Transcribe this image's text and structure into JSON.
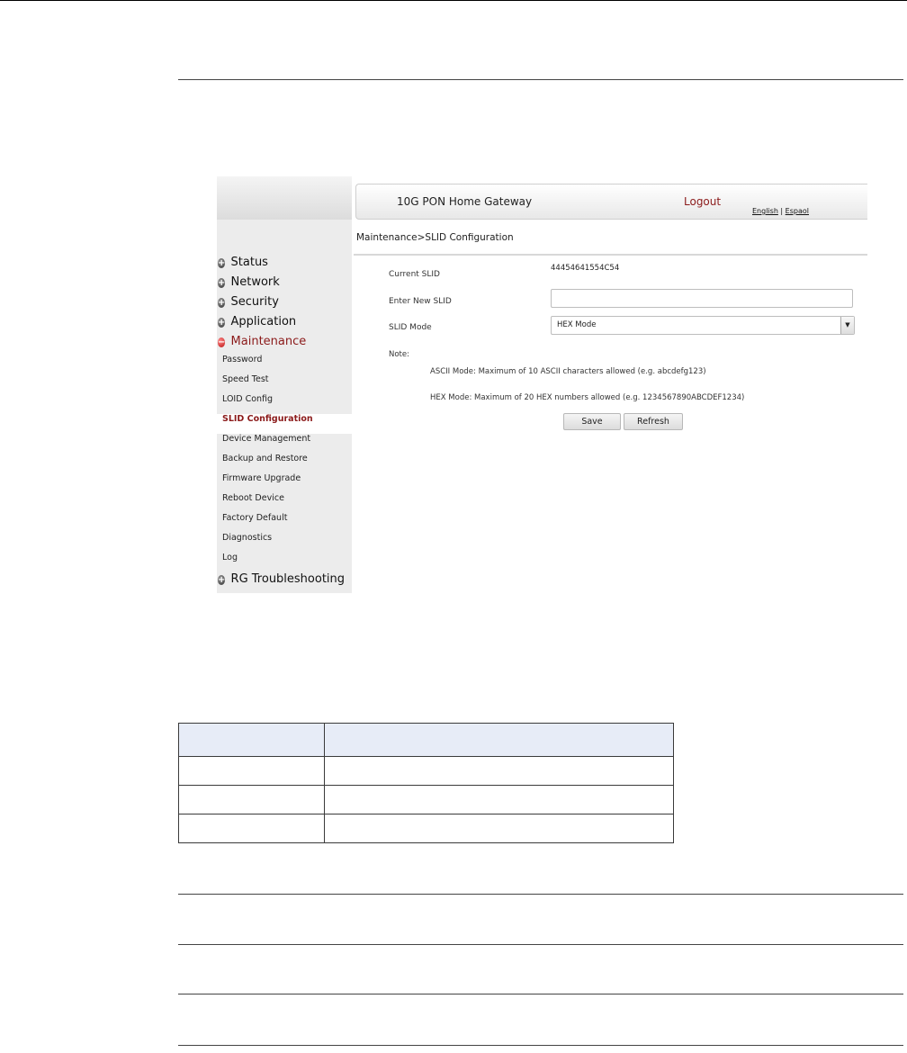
{
  "sidebar": {
    "menu": [
      {
        "label": "Status",
        "expanded": false
      },
      {
        "label": "Network",
        "expanded": false
      },
      {
        "label": "Security",
        "expanded": false
      },
      {
        "label": "Application",
        "expanded": false
      },
      {
        "label": "Maintenance",
        "expanded": true
      }
    ],
    "maintenance_items": [
      {
        "label": "Password"
      },
      {
        "label": "Speed Test"
      },
      {
        "label": "LOID Config"
      },
      {
        "label": "SLID Configuration",
        "active": true
      },
      {
        "label": "Device Management"
      },
      {
        "label": "Backup and Restore"
      },
      {
        "label": "Firmware Upgrade"
      },
      {
        "label": "Reboot Device"
      },
      {
        "label": "Factory Default"
      },
      {
        "label": "Diagnostics"
      },
      {
        "label": "Log"
      }
    ],
    "last_menu": {
      "label": "RG Troubleshooting",
      "expanded": false
    }
  },
  "header": {
    "title": "10G PON Home Gateway",
    "logout": "Logout",
    "lang_english": "English",
    "lang_separator": " | ",
    "lang_espanol": "Espaol"
  },
  "breadcrumb": "Maintenance>SLID Configuration",
  "form": {
    "current_slid_label": "Current SLID",
    "current_slid_value": "44454641554C54",
    "new_slid_label": "Enter New SLID",
    "new_slid_value": "",
    "slid_mode_label": "SLID Mode",
    "slid_mode_value": "HEX Mode",
    "note_label": "Note:",
    "note_ascii": "ASCII Mode: Maximum of 10 ASCII characters allowed (e.g. abcdefg123)",
    "note_hex": "HEX Mode: Maximum of 20 HEX numbers allowed (e.g. 1234567890ABCDEF1234)",
    "save_label": "Save",
    "refresh_label": "Refresh"
  },
  "colors": {
    "accent": "#8b1a1a",
    "table_header_bg": "#e7ecf7"
  }
}
